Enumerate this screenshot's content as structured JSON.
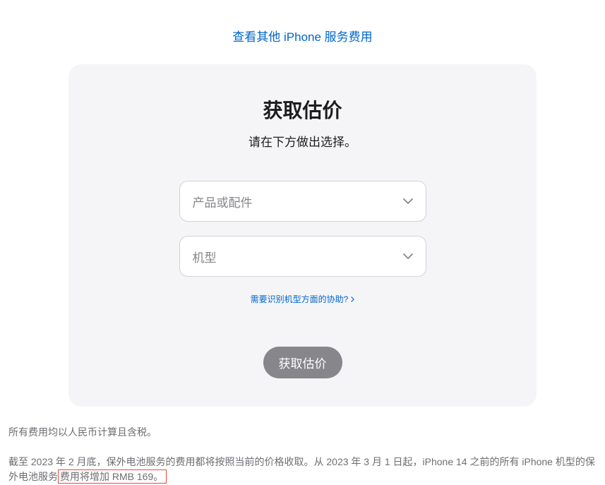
{
  "topLink": {
    "text": "查看其他 iPhone 服务费用"
  },
  "card": {
    "title": "获取估价",
    "subtitle": "请在下方做出选择。",
    "select1": {
      "placeholder": "产品或配件"
    },
    "select2": {
      "placeholder": "机型"
    },
    "helpLink": "需要识别机型方面的协助?",
    "submit": "获取估价"
  },
  "footer": {
    "line1": "所有费用均以人民币计算且含税。",
    "line2_prefix": "截至 2023 年 2 月底，保外电池服务的费用都将按照当前的价格收取。从 2023 年 3 月 1 日起，iPhone 14 之前的所有 iPhone 机型的保外电池服务",
    "line2_highlight": "费用将增加 RMB 169。"
  }
}
